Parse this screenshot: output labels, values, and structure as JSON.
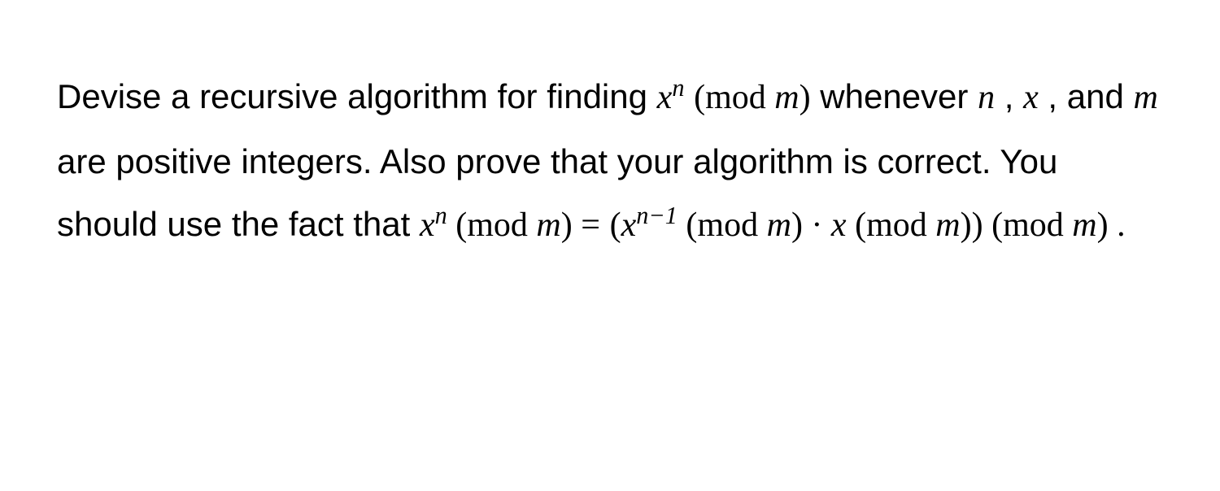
{
  "problem": {
    "t1": "Devise a recursive algorithm for finding ",
    "e1_var": "x",
    "e1_sup_n": "n",
    "e2_open": "(",
    "e2_mod": "mod ",
    "e2_m": "m",
    "e2_close": ")",
    "t2": " whenever ",
    "e3_n": "n",
    "t3": " , ",
    "e4_x": "x",
    "t4": " , and ",
    "e5_m": "m",
    "t5": " are positive integers. Also prove that your algorithm is correct. You should use the fact that ",
    "e6_x": "x",
    "e6_sup_n": "n",
    "e7_open": " (",
    "e7_mod": "mod ",
    "e7_m": "m",
    "e7_close": ") ",
    "e8_eq": "=",
    "e9_open": "(",
    "e9_x": "x",
    "e9_sup": "n−1",
    "e9_sep1": " (",
    "e9_mod1": "mod ",
    "e9_m1": "m",
    "e9_close1": ") · ",
    "e9_x2": "x",
    "e9_sep2": " (",
    "e9_mod2": "mod ",
    "e9_m2": "m",
    "e9_close2": "))",
    "e10_sep": " (",
    "e10_mod": "mod ",
    "e10_m": "m",
    "e10_close": ") ."
  }
}
